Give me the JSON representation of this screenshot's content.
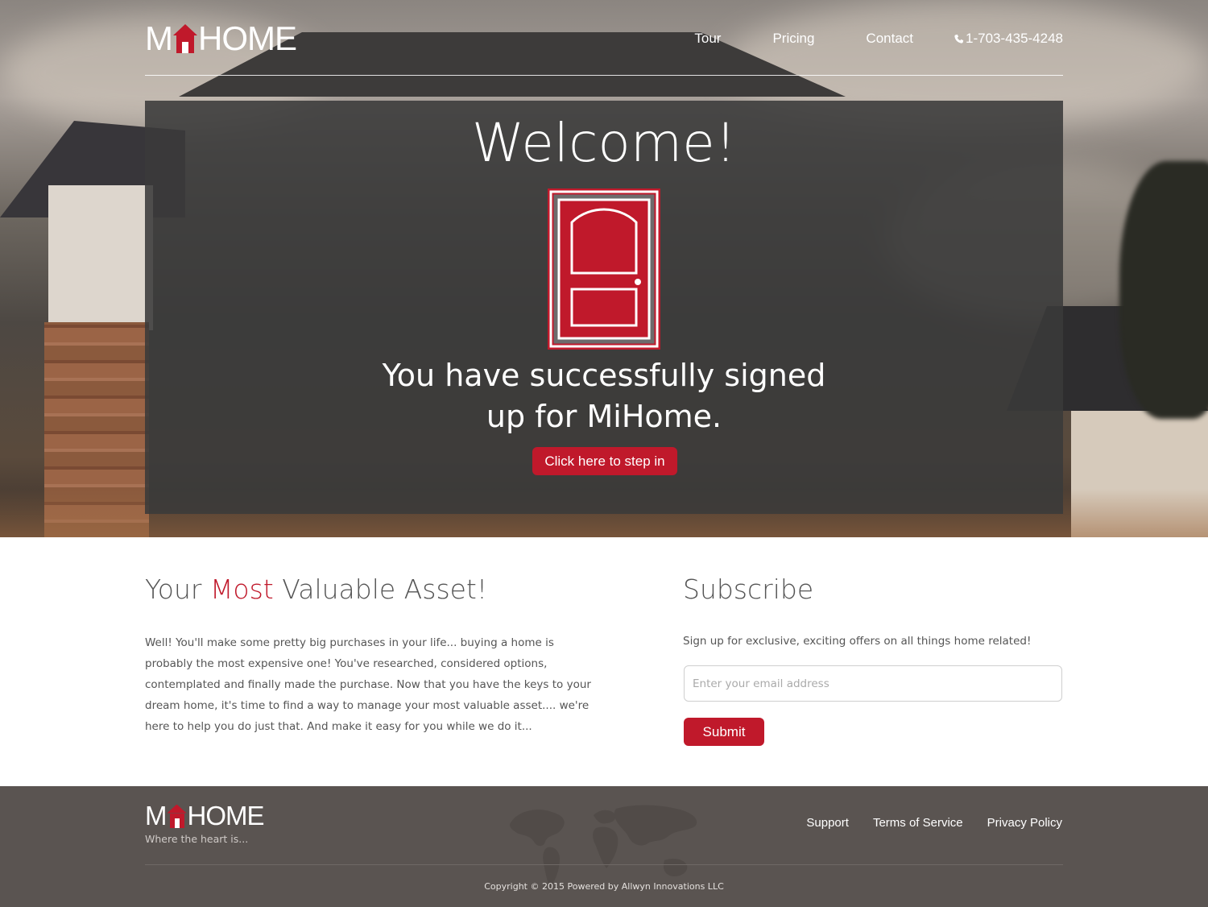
{
  "brand": {
    "logo_left": "M",
    "logo_right": "HOME",
    "tagline": "Where the heart is...",
    "accent_color": "#c0192b"
  },
  "nav": {
    "items": [
      {
        "label": "Tour"
      },
      {
        "label": "Pricing"
      },
      {
        "label": "Contact"
      }
    ],
    "phone": "1-703-435-4248",
    "phone_icon": "phone-icon"
  },
  "hero": {
    "title": "Welcome!",
    "door_icon": "door-icon",
    "message_line1": "You have successfully signed",
    "message_line2": "up for MiHome.",
    "cta_label": "Click here to step in"
  },
  "about": {
    "title_before": "Your ",
    "title_accent": "Most",
    "title_after": " Valuable Asset!",
    "body": "Well! You'll make some pretty big purchases in your life... buying a home is probably the most expensive one! You've researched, considered options, contemplated and finally made the purchase. Now that you have the keys to your dream home, it's time to find a way to manage your most valuable asset.... we're here to help you do just that. And make it easy for you while we do it..."
  },
  "subscribe": {
    "title": "Subscribe",
    "description": "Sign up for exclusive, exciting offers on all things home related!",
    "email_placeholder": "Enter your email address",
    "email_value": "",
    "submit_label": "Submit"
  },
  "footer": {
    "links": [
      {
        "label": "Support"
      },
      {
        "label": "Terms of Service"
      },
      {
        "label": "Privacy Policy"
      }
    ],
    "copyright": "Copyright © 2015 Powered by Allwyn Innovations LLC",
    "map_icon": "world-map-icon"
  }
}
